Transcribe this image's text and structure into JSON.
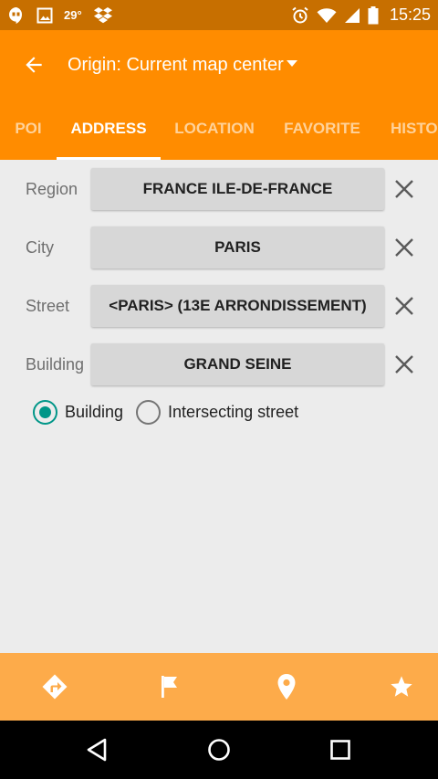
{
  "status_bar": {
    "temperature": "29°",
    "time": "15:25",
    "icons": [
      "hangouts-icon",
      "image-icon",
      "dropbox-icon",
      "alarm-icon",
      "wifi-icon",
      "signal-icon",
      "battery-icon"
    ]
  },
  "app_bar": {
    "title": "Origin: Current map center",
    "back_icon": "arrow-left-icon",
    "dropdown_icon": "caret-down-icon"
  },
  "tabs": [
    {
      "label": "POI",
      "active": false
    },
    {
      "label": "ADDRESS",
      "active": true
    },
    {
      "label": "LOCATION",
      "active": false
    },
    {
      "label": "FAVORITE",
      "active": false
    },
    {
      "label": "HISTORY",
      "active": false
    }
  ],
  "form": {
    "rows": [
      {
        "label": "Region",
        "value": "FRANCE ILE-DE-FRANCE"
      },
      {
        "label": "City",
        "value": "PARIS"
      },
      {
        "label": "Street",
        "value": "<PARIS> (13E ARRONDISSEMENT)"
      },
      {
        "label": "Building",
        "value": "GRAND SEINE"
      }
    ],
    "clear_icon": "close-icon"
  },
  "radio": {
    "options": [
      {
        "label": "Building",
        "checked": true
      },
      {
        "label": "Intersecting street",
        "checked": false
      }
    ]
  },
  "bottom_bar": {
    "icons": [
      "directions-icon",
      "flag-icon",
      "location-pin-icon",
      "star-icon"
    ]
  },
  "nav_bar": {
    "icons": [
      "back-triangle-icon",
      "home-circle-icon",
      "recents-square-icon"
    ]
  },
  "colors": {
    "app_bar": "#ff8c00",
    "status_bar": "#c76f00",
    "bottom_bar": "#fdab4a",
    "radio_accent": "#009688"
  }
}
